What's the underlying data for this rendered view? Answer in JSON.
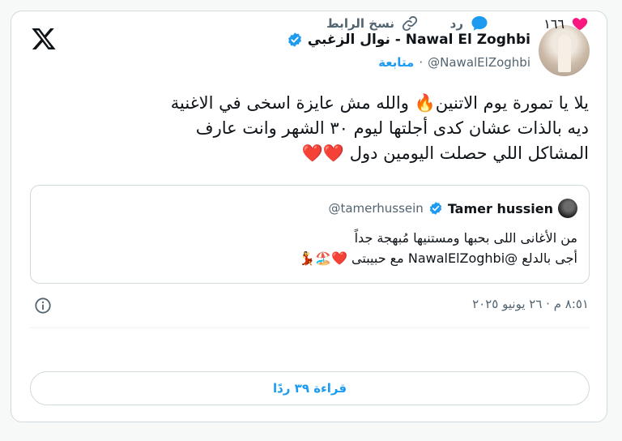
{
  "colors": {
    "accent": "#1d9bf0",
    "like": "#f91880",
    "text": "#0f1419",
    "muted": "#536471",
    "border": "#cfd9de"
  },
  "header": {
    "logo_icon": "x-logo-icon",
    "name": "Nawal El Zoghbi - نوال الزغبي",
    "handle": "@NawalElZoghbi",
    "separator": "·",
    "follow_label": "متابعة",
    "verified_icon": "verified-badge-icon"
  },
  "tweet": {
    "lines": [
      "يلا يا تمورة يوم الاتنين🔥 والله مش عايزة اسخى في الاغنية",
      "ديه بالذات عشان كدى أجلتها ليوم ٣٠ الشهر  وانت عارف",
      "المشاكل اللي حصلت اليومين دول ❤️❤️"
    ]
  },
  "quote": {
    "name": "Tamer hussien",
    "handle": "@tamerhussein",
    "lines": [
      "من الأغانى اللى بحبها ومستنيها مُبهجة جداً",
      "أجى بالدلع @NawalElZoghbi مع حبيبتى ❤️🏖️💃"
    ]
  },
  "meta": {
    "timestamp": "٨:٥١ م · ٢٦ يونيو ٢٠٢٥",
    "info_icon": "info-icon"
  },
  "actions": {
    "like_count": "١٦٦",
    "reply_label": "رد",
    "copy_label": "نسخ الرابط"
  },
  "read_replies_label": "قراءة ٣٩ ردًا"
}
